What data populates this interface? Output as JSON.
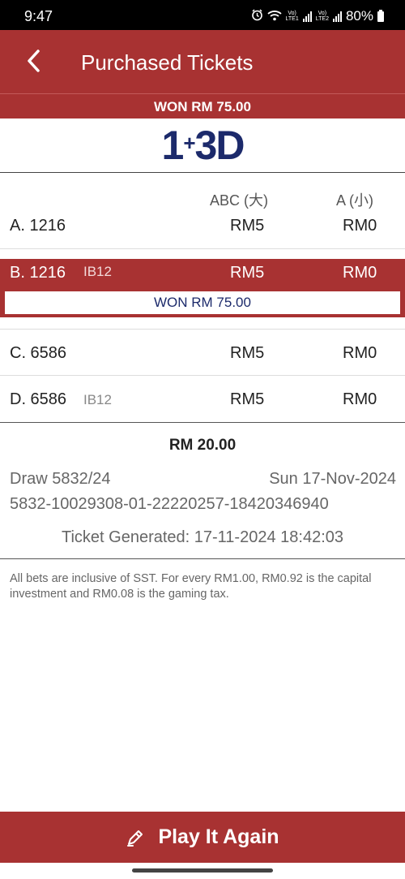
{
  "status_bar": {
    "time": "9:47",
    "battery": "80%",
    "icons": [
      "alarm-icon",
      "wifi-icon",
      "lte1-signal-icon",
      "lte2-signal-icon",
      "battery-icon"
    ]
  },
  "header": {
    "title": "Purchased Tickets",
    "back_icon": "chevron-left-icon"
  },
  "won_banner": "WON RM 75.00",
  "logo": {
    "left": "1",
    "plus": "+",
    "right": "3D"
  },
  "columns": {
    "abc": "ABC (大)",
    "a": "A (小)"
  },
  "bets": [
    {
      "label": "A. 1216",
      "tag": "",
      "abc": "RM5",
      "a": "RM0",
      "winner": false
    },
    {
      "label": "B. 1216",
      "tag": "IB12",
      "abc": "RM5",
      "a": "RM0",
      "winner": true,
      "won_text": "WON RM 75.00"
    },
    {
      "label": "C. 6586",
      "tag": "",
      "abc": "RM5",
      "a": "RM0",
      "winner": false
    },
    {
      "label": "D. 6586",
      "tag": "IB12",
      "abc": "RM5",
      "a": "RM0",
      "winner": false
    }
  ],
  "summary": {
    "total": "RM 20.00",
    "draw": "Draw 5832/24",
    "date": "Sun 17-Nov-2024",
    "serial": "5832-10029308-01-22220257-18420346940",
    "generated": "Ticket Generated: 17-11-2024 18:42:03"
  },
  "disclaimer": "All bets are inclusive of SST. For every RM1.00, RM0.92 is the capital investment and RM0.08 is the gaming tax.",
  "play_button": {
    "label": "Play It Again",
    "icon": "pencil-icon"
  },
  "colors": {
    "brand_red": "#a83232",
    "logo_navy": "#1c2a6b"
  }
}
